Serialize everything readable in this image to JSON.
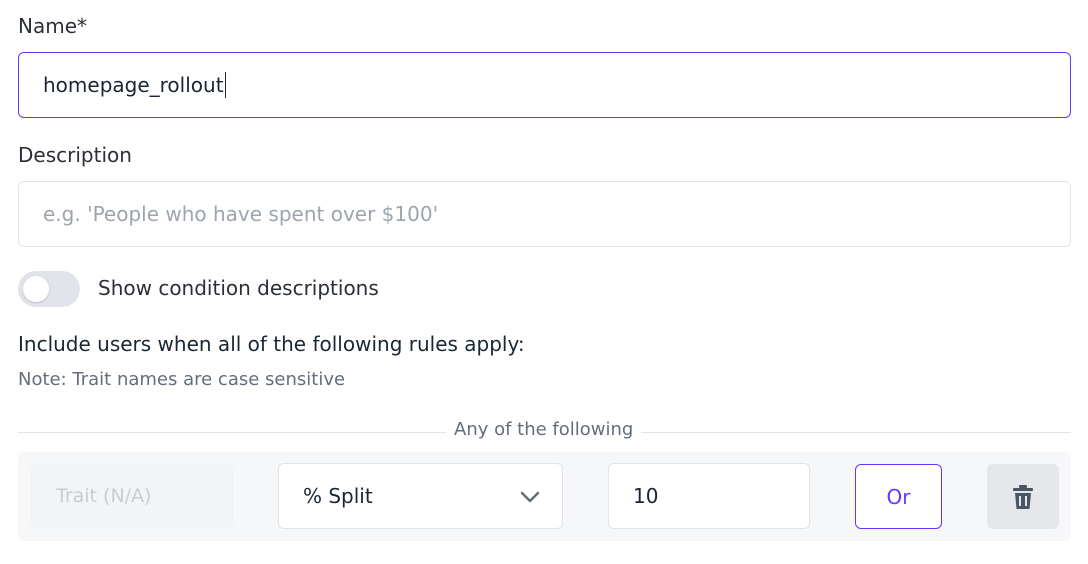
{
  "form": {
    "name_label": "Name*",
    "name_value": "homepage_rollout",
    "description_label": "Description",
    "description_placeholder": "e.g. 'People who have spent over $100'",
    "toggle_label": "Show condition descriptions",
    "toggle_on": false
  },
  "rules": {
    "title": "Include users when all of the following rules apply:",
    "note": "Note: Trait names are case sensitive",
    "group_label": "Any of the following",
    "row": {
      "trait_placeholder": "Trait (N/A)",
      "operator": "% Split",
      "value": "10",
      "or_label": "Or"
    }
  },
  "colors": {
    "accent": "#6837fc",
    "border": "#e0e3e9",
    "muted_text": "#656d7b"
  },
  "icons": {
    "chevron": "chevron-down-icon",
    "delete": "trash-icon"
  }
}
